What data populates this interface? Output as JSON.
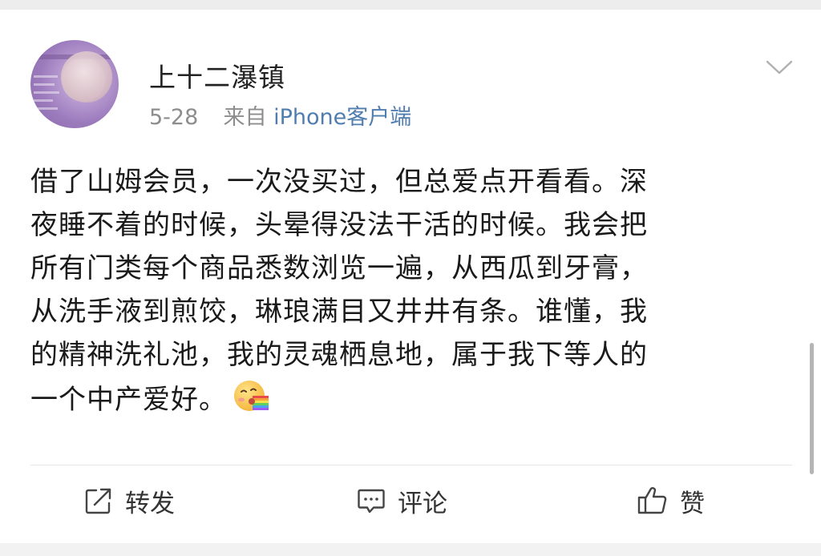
{
  "post": {
    "username": "上十二瀑镇",
    "date": "5-28",
    "source_prefix": "来自",
    "source_app": "iPhone客户端",
    "body_lines": [
      "借了山姆会员，一次没买过，但总爱点开看看。深",
      "夜睡不着的时候，头晕得没法干活的时候。我会把",
      "所有门类每个商品悉数浏览一遍，从西瓜到牙膏，",
      "从洗手液到煎饺，琳琅满目又井井有条。谁懂，我",
      "的精神洗礼池，我的灵魂栖息地，属于我下等人的",
      "一个中产爱好。"
    ],
    "emoji": "rainbow-vomit-emoji"
  },
  "actions": {
    "repost_label": "转发",
    "comment_label": "评论",
    "like_label": "赞"
  },
  "icons": {
    "chevron": "chevron-down-icon",
    "repost": "repost-icon",
    "comment": "comment-icon",
    "like": "thumbs-up-icon"
  },
  "colors": {
    "link": "#507daf",
    "meta": "#8d8d8d",
    "text": "#1a1a1a"
  }
}
